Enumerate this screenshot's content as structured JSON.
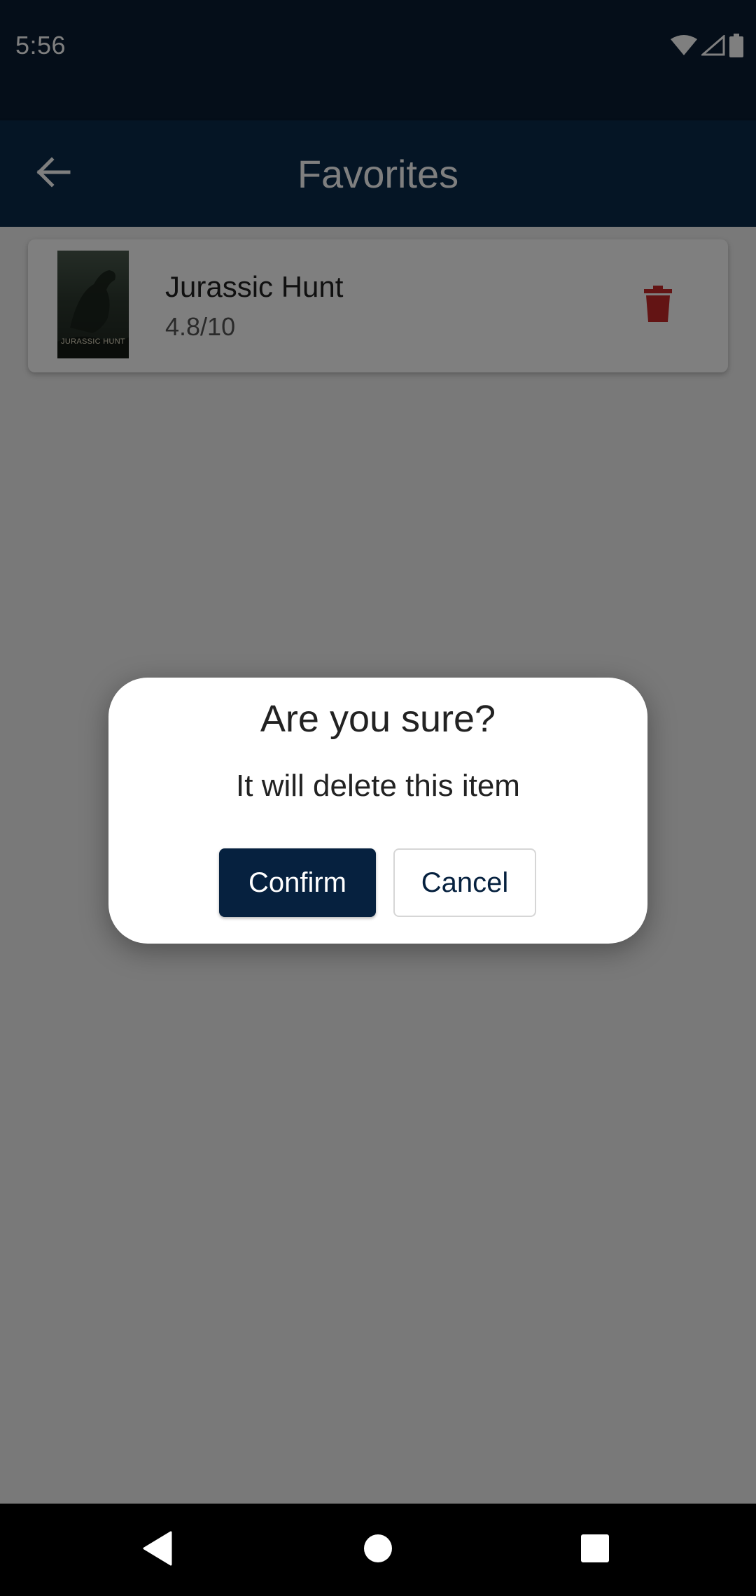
{
  "status_bar": {
    "time": "5:56",
    "icons": [
      "wifi-icon",
      "signal-icon",
      "battery-icon"
    ]
  },
  "app_bar": {
    "title": "Favorites",
    "back_icon": "arrow-left-icon"
  },
  "favorites": [
    {
      "title": "Jurassic Hunt",
      "rating": "4.8/10",
      "poster_text": "JURASSIC HUNT",
      "delete_icon": "trash-icon"
    }
  ],
  "dialog": {
    "title": "Are you sure?",
    "message": "It will delete this item",
    "confirm_label": "Confirm",
    "cancel_label": "Cancel"
  },
  "nav_bar": {
    "icons": [
      "back-triangle-icon",
      "home-circle-icon",
      "recents-square-icon"
    ]
  },
  "colors": {
    "status_bar": "#0a1c32",
    "app_bar": "#0a2a4b",
    "primary_button": "#06213f",
    "delete_icon": "#c62828"
  }
}
